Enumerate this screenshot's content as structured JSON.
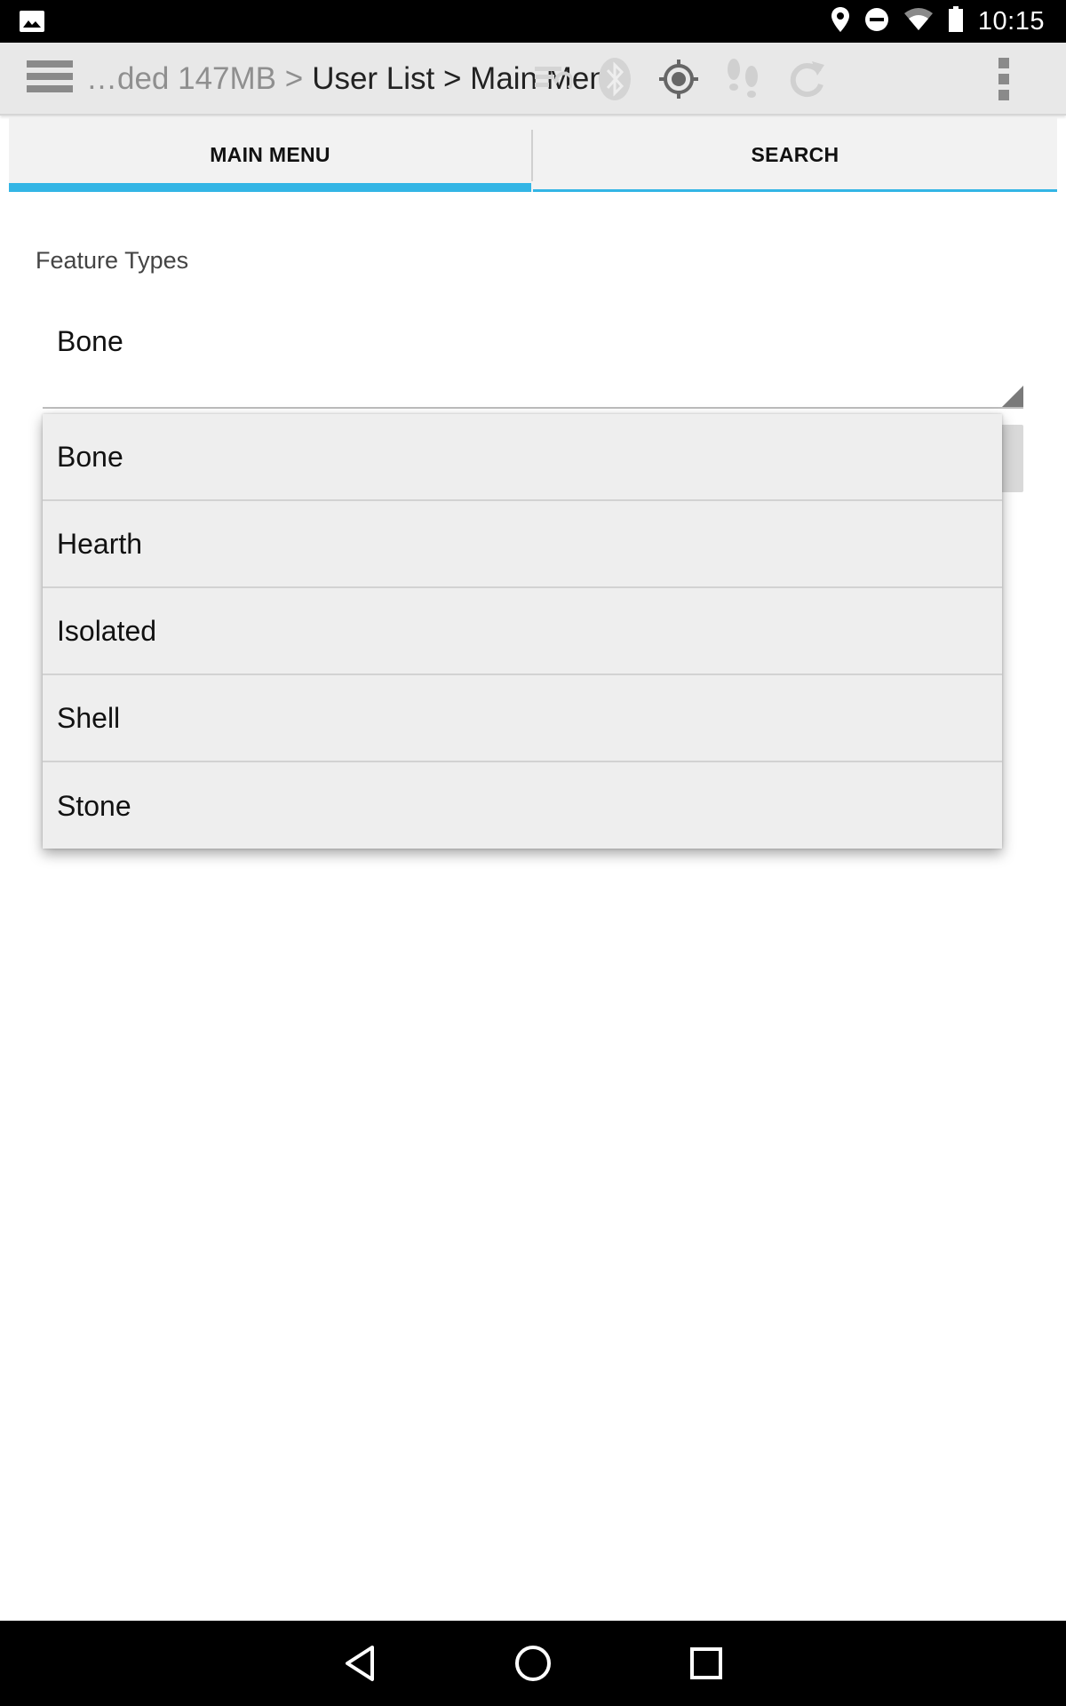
{
  "status_bar": {
    "time": "10:15",
    "icons": [
      "image-icon",
      "location-icon",
      "do-not-disturb-icon",
      "wifi-icon",
      "battery-icon"
    ]
  },
  "action_bar": {
    "breadcrumb_muted": "…ded 147MB >",
    "breadcrumb_main": "User List > Main Menu",
    "icons": [
      "menu-icon",
      "sync-data-icon",
      "bluetooth-icon",
      "gps-icon",
      "footsteps-icon",
      "refresh-icon",
      "overflow-icon"
    ]
  },
  "tabs": [
    {
      "label": "MAIN MENU",
      "active": true
    },
    {
      "label": "SEARCH",
      "active": false
    }
  ],
  "form": {
    "label": "Feature Types",
    "selected": "Bone"
  },
  "dropdown": {
    "options": [
      "Bone",
      "Hearth",
      "Isolated",
      "Shell",
      "Stone"
    ]
  },
  "colors": {
    "accent": "#33b5e5",
    "action_bar": "#e8e8e8",
    "dropdown_bg": "#eeeeee"
  },
  "nav_bar": {
    "icons": [
      "back-icon",
      "home-icon",
      "recents-icon"
    ]
  }
}
